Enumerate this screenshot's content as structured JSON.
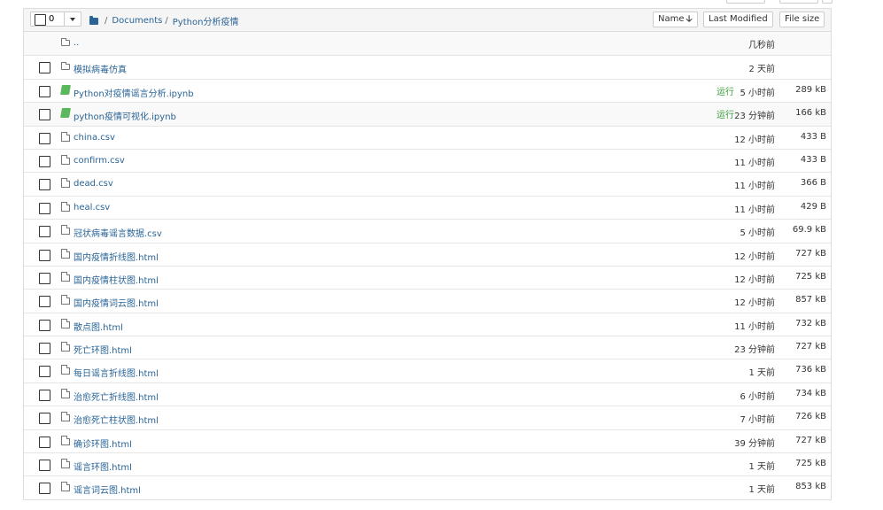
{
  "header": {
    "selected_count": "0",
    "breadcrumb": {
      "documents": "Documents",
      "current": "Python分析疫情"
    },
    "sort_buttons": {
      "name": "Name",
      "name_arrow": "🡣",
      "last_modified": "Last Modified",
      "file_size": "File size"
    }
  },
  "items": [
    {
      "type": "up",
      "name": "..",
      "running": "",
      "modified": "几秒前",
      "size": ""
    },
    {
      "type": "folder",
      "name": "模拟病毒仿真",
      "running": "",
      "modified": "2 天前",
      "size": ""
    },
    {
      "type": "notebook",
      "name": "Python对疫情谣言分析.ipynb",
      "running": "运行",
      "modified": "5 小时前",
      "size": "289 kB"
    },
    {
      "type": "notebook",
      "name": "python疫情可视化.ipynb",
      "running": "运行",
      "modified": "23 分钟前",
      "size": "166 kB"
    },
    {
      "type": "file",
      "name": "china.csv",
      "running": "",
      "modified": "12 小时前",
      "size": "433 B"
    },
    {
      "type": "file",
      "name": "confirm.csv",
      "running": "",
      "modified": "11 小时前",
      "size": "433 B"
    },
    {
      "type": "file",
      "name": "dead.csv",
      "running": "",
      "modified": "11 小时前",
      "size": "366 B"
    },
    {
      "type": "file",
      "name": "heal.csv",
      "running": "",
      "modified": "11 小时前",
      "size": "429 B"
    },
    {
      "type": "file",
      "name": "冠状病毒谣言数据.csv",
      "running": "",
      "modified": "5 小时前",
      "size": "69.9 kB"
    },
    {
      "type": "file",
      "name": "国内疫情折线图.html",
      "running": "",
      "modified": "12 小时前",
      "size": "727 kB"
    },
    {
      "type": "file",
      "name": "国内疫情柱状图.html",
      "running": "",
      "modified": "12 小时前",
      "size": "725 kB"
    },
    {
      "type": "file",
      "name": "国内疫情词云图.html",
      "running": "",
      "modified": "12 小时前",
      "size": "857 kB"
    },
    {
      "type": "file",
      "name": "散点图.html",
      "running": "",
      "modified": "11 小时前",
      "size": "732 kB"
    },
    {
      "type": "file",
      "name": "死亡环图.html",
      "running": "",
      "modified": "23 分钟前",
      "size": "727 kB"
    },
    {
      "type": "file",
      "name": "每日谣言折线图.html",
      "running": "",
      "modified": "1 天前",
      "size": "736 kB"
    },
    {
      "type": "file",
      "name": "治愈死亡折线图.html",
      "running": "",
      "modified": "6 小时前",
      "size": "734 kB"
    },
    {
      "type": "file",
      "name": "治愈死亡柱状图.html",
      "running": "",
      "modified": "7 小时前",
      "size": "726 kB"
    },
    {
      "type": "file",
      "name": "确诊环图.html",
      "running": "",
      "modified": "39 分钟前",
      "size": "727 kB"
    },
    {
      "type": "file",
      "name": "谣言环图.html",
      "running": "",
      "modified": "1 天前",
      "size": "725 kB"
    },
    {
      "type": "file",
      "name": "谣言词云图.html",
      "running": "",
      "modified": "1 天前",
      "size": "853 kB"
    }
  ]
}
